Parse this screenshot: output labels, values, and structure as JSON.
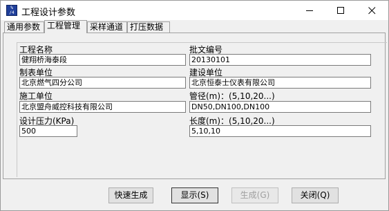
{
  "window": {
    "title": "工程设计参数"
  },
  "tabs": [
    {
      "label": "通用参数"
    },
    {
      "label": "工程管理"
    },
    {
      "label": "采样通道"
    },
    {
      "label": "打压数据"
    }
  ],
  "form": {
    "project_name": {
      "label": "工程名称",
      "value": "健翔桥海泰段"
    },
    "approval_no": {
      "label": "批文编号",
      "value": "20130101"
    },
    "drafting_unit": {
      "label": "制表单位",
      "value": "北京燃气四分公司"
    },
    "construction_unit": {
      "label": "建设单位",
      "value": "北京恒泰士仪表有限公司"
    },
    "installation_unit": {
      "label": "施工单位",
      "value": "北京盟舟威控科技有限公司"
    },
    "pipe_diameter": {
      "label": "管径(m)：(5,10,20...)",
      "value": "DN50,DN100,DN100"
    },
    "design_pressure": {
      "label": "设计压力(KPa)",
      "value": "500"
    },
    "length": {
      "label": "长度(m)：(5,10,20...)",
      "value": "5,10,10"
    }
  },
  "buttons": {
    "quick_generate": "快速生成",
    "display": "显示(S)",
    "generate": "生成(G)",
    "close": "关闭(Q)"
  }
}
